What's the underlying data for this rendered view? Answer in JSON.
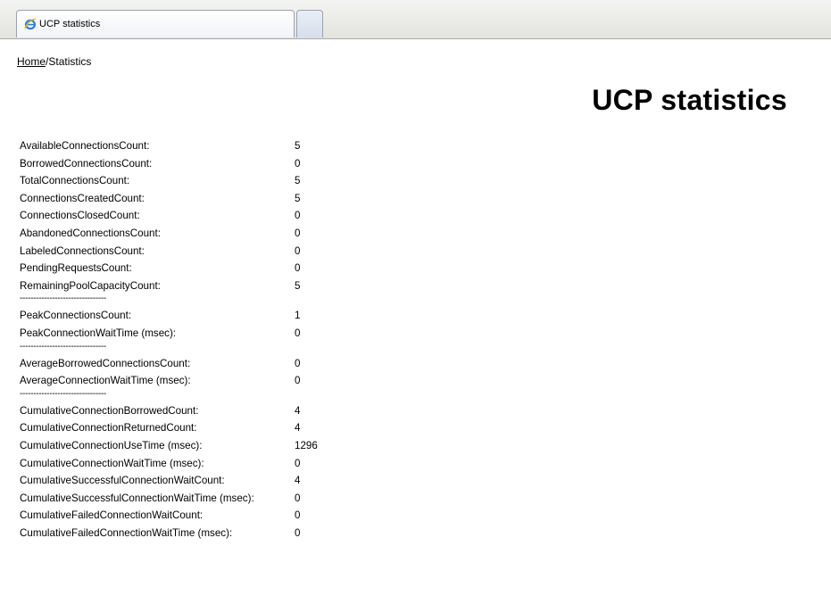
{
  "browser": {
    "tab_title": "UCP statistics"
  },
  "breadcrumb": {
    "home_link": "Home",
    "separator": "/",
    "current": "Statistics"
  },
  "page_title": "UCP statistics",
  "separator_text": "--------------------------------",
  "groups": [
    [
      {
        "label": "AvailableConnectionsCount:",
        "value": "5"
      },
      {
        "label": "BorrowedConnectionsCount:",
        "value": "0"
      },
      {
        "label": "TotalConnectionsCount:",
        "value": "5"
      },
      {
        "label": "ConnectionsCreatedCount:",
        "value": "5"
      },
      {
        "label": "ConnectionsClosedCount:",
        "value": "0"
      },
      {
        "label": "AbandonedConnectionsCount:",
        "value": "0"
      },
      {
        "label": "LabeledConnectionsCount:",
        "value": "0"
      },
      {
        "label": "PendingRequestsCount:",
        "value": "0"
      },
      {
        "label": "RemainingPoolCapacityCount:",
        "value": "5"
      }
    ],
    [
      {
        "label": "PeakConnectionsCount:",
        "value": "1"
      },
      {
        "label": "PeakConnectionWaitTime (msec):",
        "value": "0"
      }
    ],
    [
      {
        "label": "AverageBorrowedConnectionsCount:",
        "value": "0"
      },
      {
        "label": "AverageConnectionWaitTime (msec):",
        "value": "0"
      }
    ],
    [
      {
        "label": "CumulativeConnectionBorrowedCount:",
        "value": "4"
      },
      {
        "label": "CumulativeConnectionReturnedCount:",
        "value": "4"
      },
      {
        "label": "CumulativeConnectionUseTime (msec):",
        "value": "1296"
      },
      {
        "label": "CumulativeConnectionWaitTime (msec):",
        "value": "0"
      },
      {
        "label": "CumulativeSuccessfulConnectionWaitCount:",
        "value": "4"
      },
      {
        "label": "CumulativeSuccessfulConnectionWaitTime (msec):",
        "value": "0"
      },
      {
        "label": "CumulativeFailedConnectionWaitCount:",
        "value": "0"
      },
      {
        "label": "CumulativeFailedConnectionWaitTime (msec):",
        "value": "0"
      }
    ]
  ]
}
